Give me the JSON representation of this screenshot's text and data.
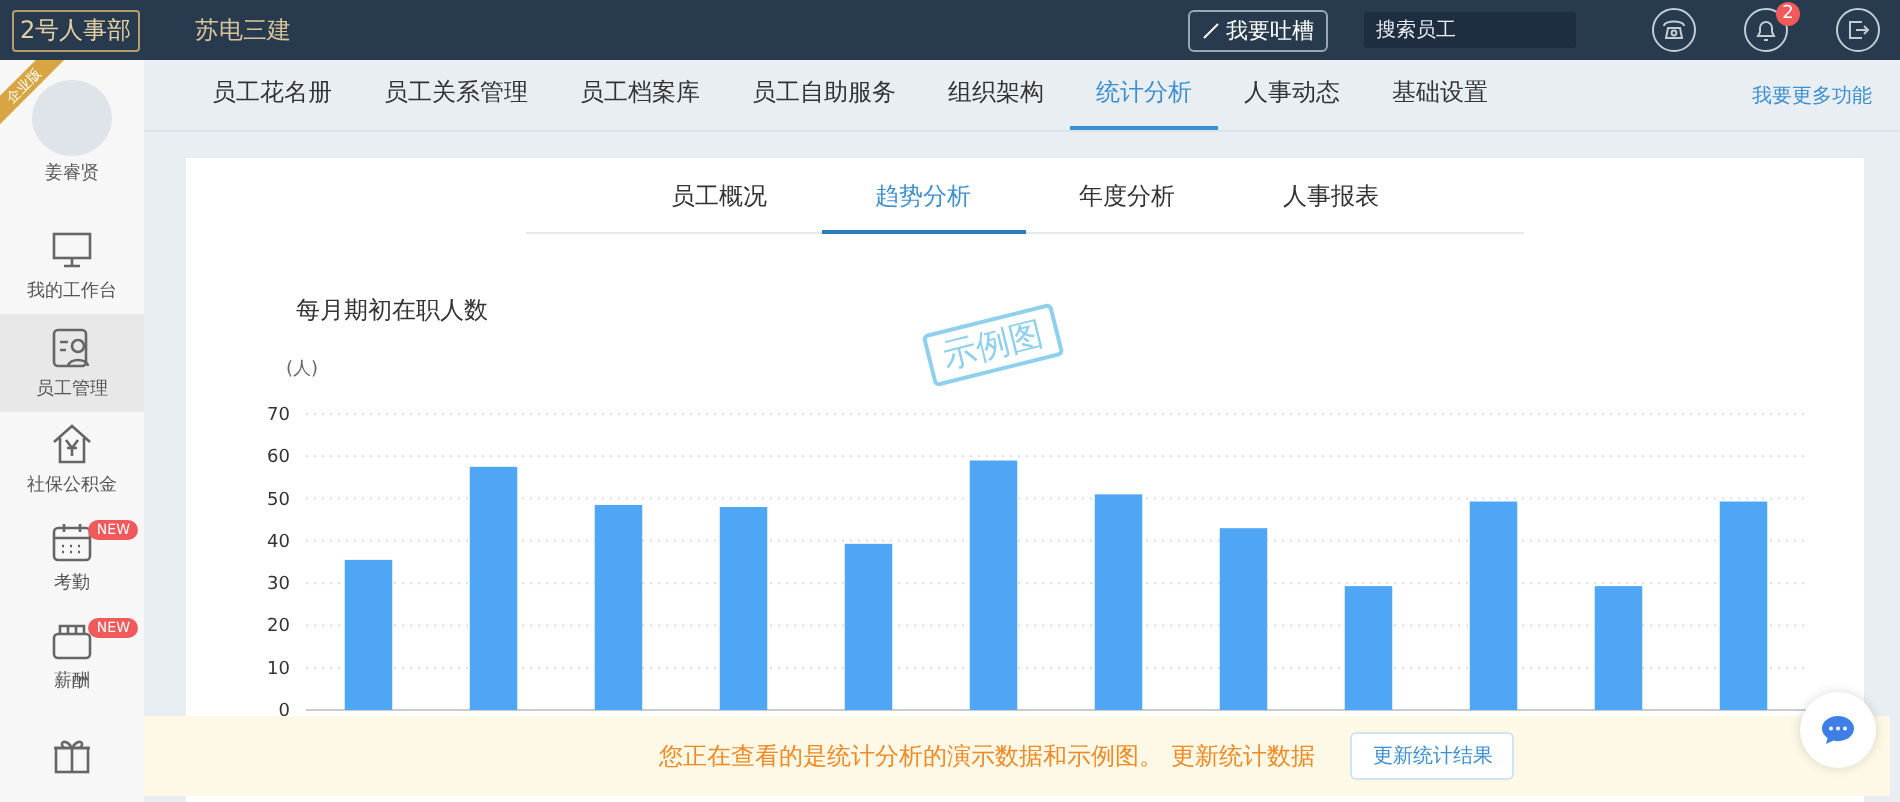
{
  "topbar": {
    "logo": "2号人事部",
    "company": "苏电三建",
    "feedback_button": "我要吐槽",
    "search": {
      "placeholder": "搜索员工"
    },
    "notification_count": "2"
  },
  "sidebar": {
    "edition_ribbon": "企业版",
    "user_name": "姜睿贤",
    "items": [
      {
        "kind": "desk",
        "label": "我的工作台",
        "selected": false
      },
      {
        "kind": "staff",
        "label": "员工管理",
        "selected": true
      },
      {
        "kind": "fund",
        "label": "社保公积金",
        "selected": false
      },
      {
        "kind": "calendar",
        "label": "考勤",
        "selected": false,
        "badge": "NEW"
      },
      {
        "kind": "wallet",
        "label": "薪酬",
        "selected": false,
        "badge": "NEW"
      },
      {
        "kind": "gift",
        "selected": false
      }
    ]
  },
  "nav": {
    "tabs": [
      {
        "label": "员工花名册",
        "selected": false
      },
      {
        "label": "员工关系管理",
        "selected": false
      },
      {
        "label": "员工档案库",
        "selected": false
      },
      {
        "label": "员工自助服务",
        "selected": false
      },
      {
        "label": "组织架构",
        "selected": false
      },
      {
        "label": "统计分析",
        "selected": true
      },
      {
        "label": "人事动态",
        "selected": false
      },
      {
        "label": "基础设置",
        "selected": false
      }
    ],
    "more_link": "我要更多功能"
  },
  "subtabs": [
    {
      "label": "员工概况",
      "selected": false
    },
    {
      "label": "趋势分析",
      "selected": true
    },
    {
      "label": "年度分析",
      "selected": false
    },
    {
      "label": "人事报表",
      "selected": false
    }
  ],
  "chart_title": "每月期初在职人数",
  "sample_stamp": "示例图",
  "chart_data": {
    "type": "bar",
    "ylabel": "(人)",
    "ylim": [
      0,
      70
    ],
    "yticks": [
      0,
      10,
      20,
      30,
      40,
      50,
      60,
      70
    ],
    "grid": true,
    "series": [
      {
        "color": "#4fa6f5",
        "values": [
          35.5,
          57.5,
          48.5,
          48,
          39.3,
          59,
          51,
          43,
          29.3,
          49.3,
          29.3,
          49.3
        ]
      }
    ]
  },
  "banner": {
    "message": "您正在查看的是统计分析的演示数据和示例图。 更新统计数据",
    "button": "更新统计结果"
  }
}
